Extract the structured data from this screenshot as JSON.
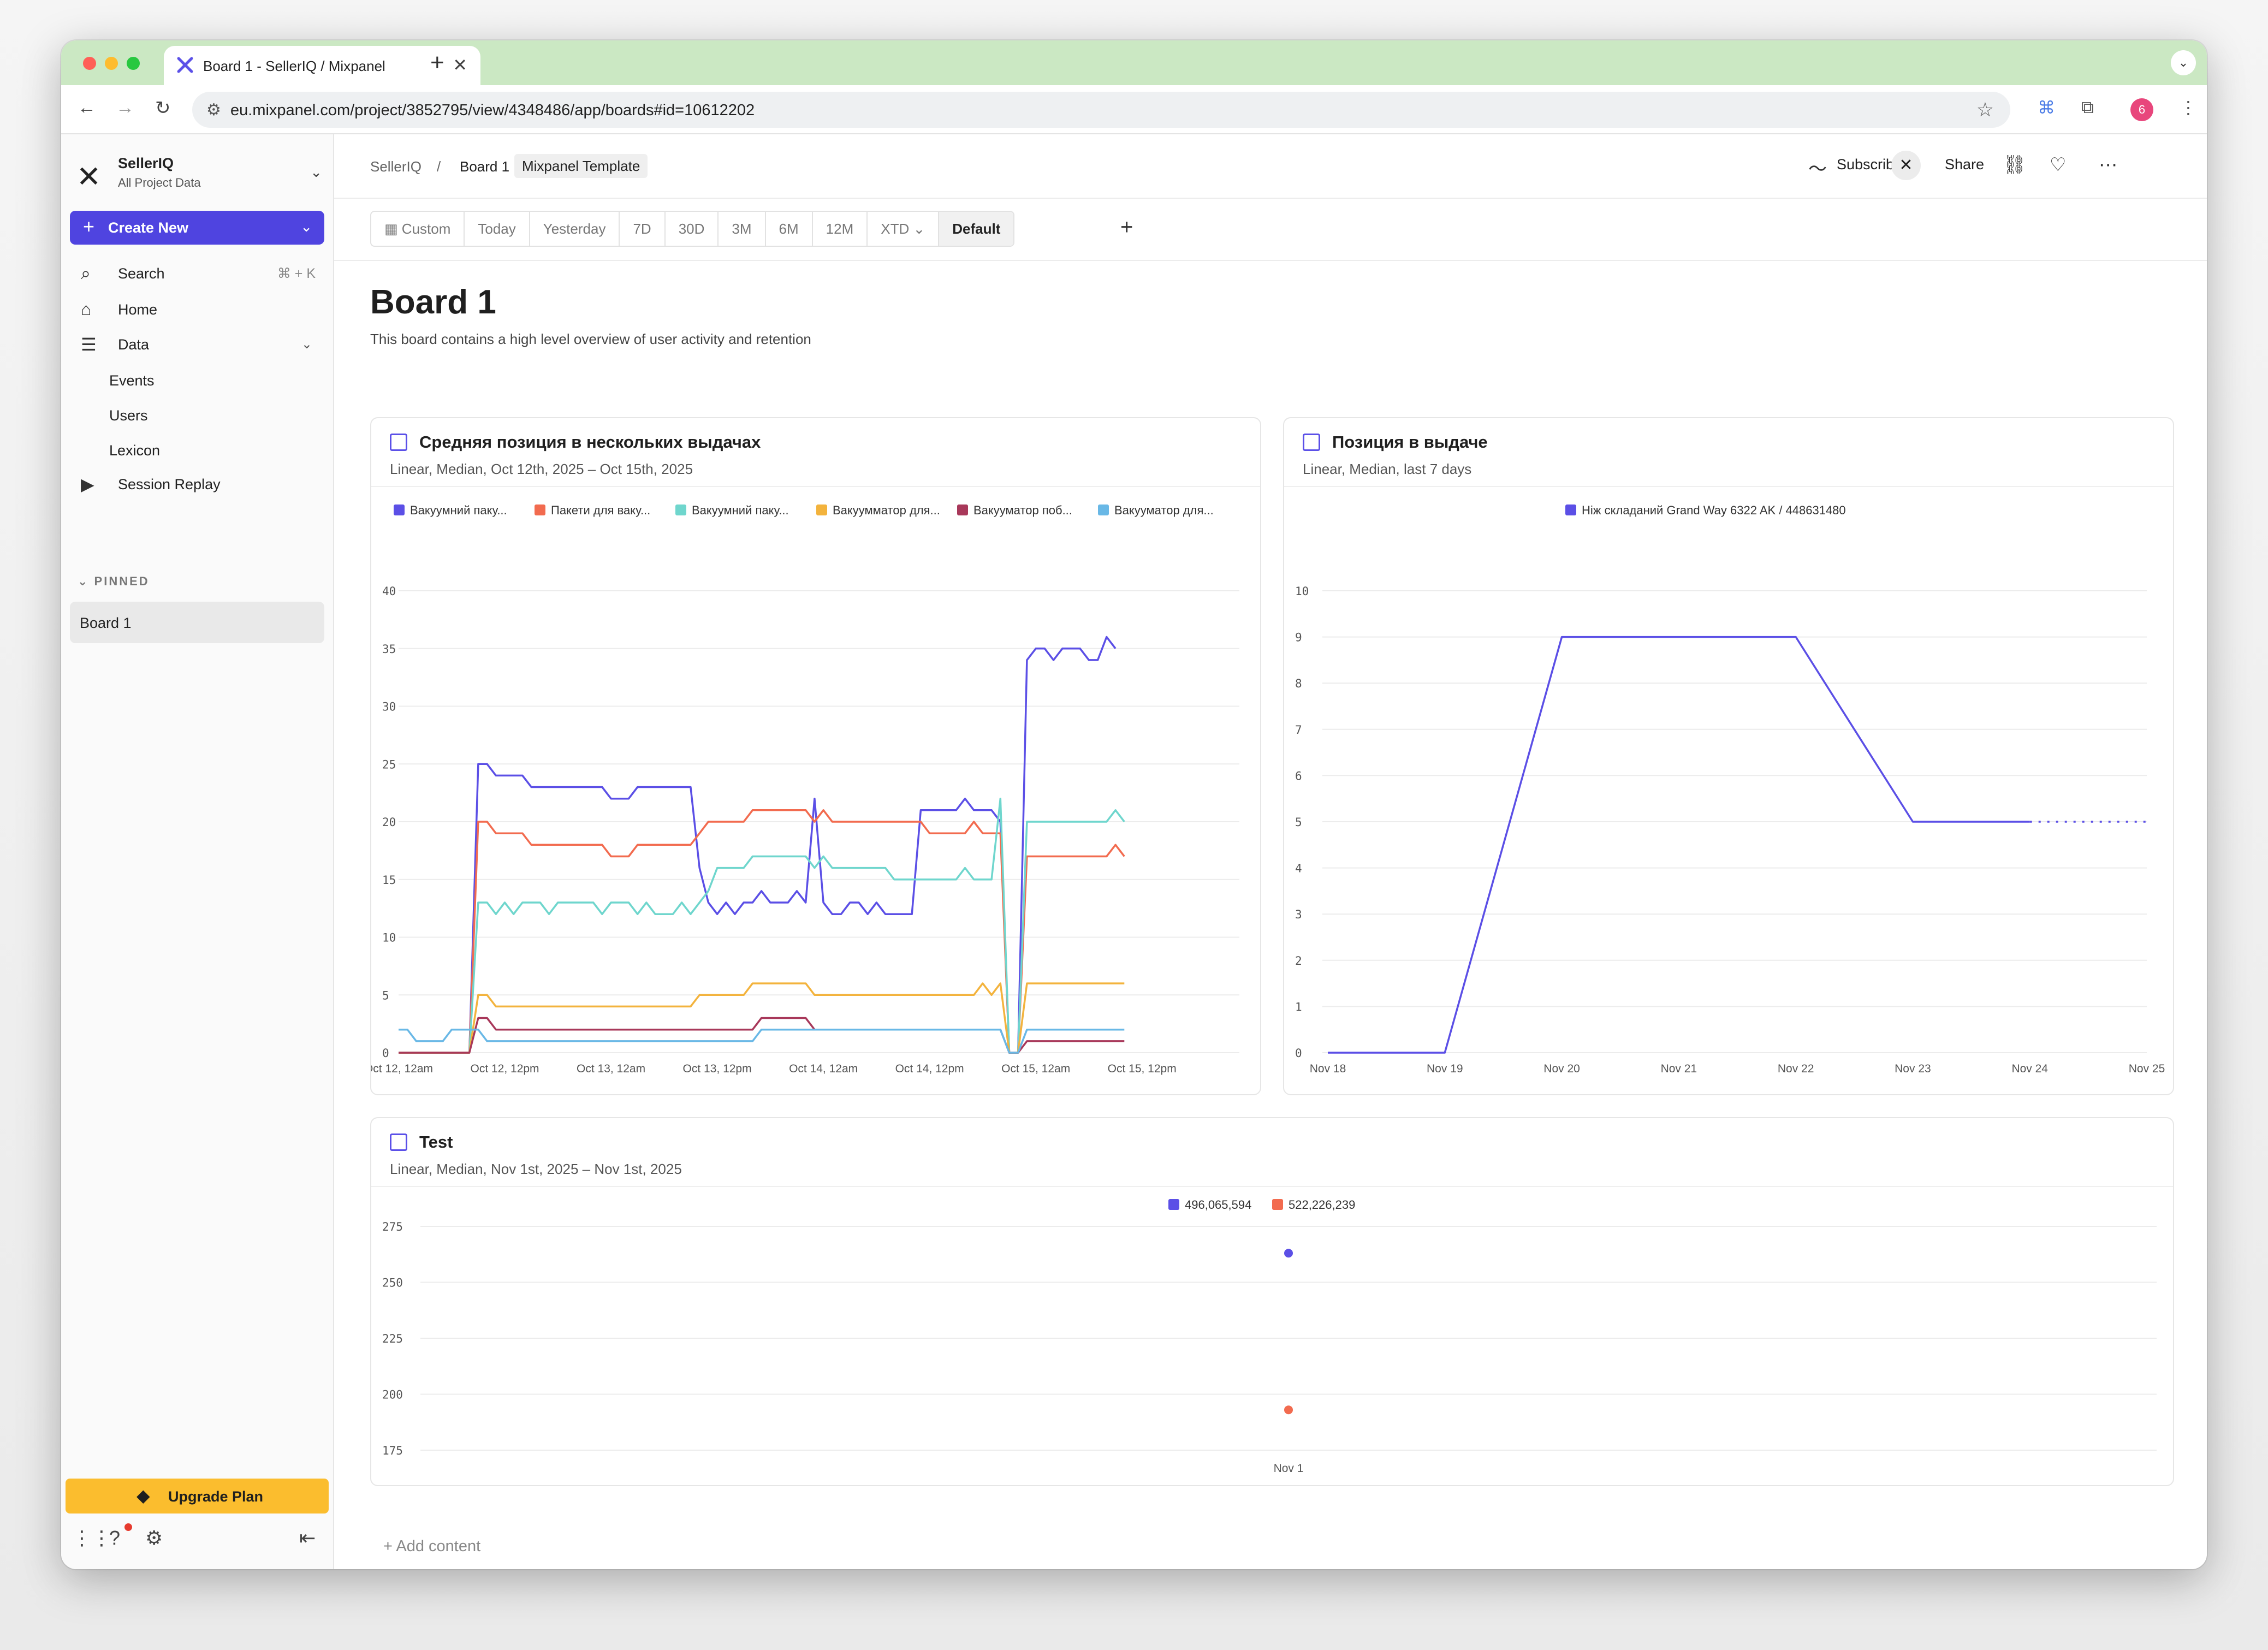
{
  "browser": {
    "tab_title": "Board 1 - SellerIQ / Mixpanel",
    "url": "eu.mixpanel.com/project/3852795/view/4348486/app/boards#id=10612202",
    "profile_badge": "6"
  },
  "sidebar": {
    "org_name": "SellerIQ",
    "org_sub": "All Project Data",
    "create_new": "Create New",
    "search": "Search",
    "search_shortcut": "⌘ + K",
    "home": "Home",
    "data": "Data",
    "events": "Events",
    "users": "Users",
    "lexicon": "Lexicon",
    "session_replay": "Session Replay",
    "pinned_header": "PINNED",
    "pinned_board": "Board 1",
    "upgrade": "Upgrade Plan"
  },
  "topbar": {
    "crumb_root": "SellerIQ",
    "crumb_sep": "/",
    "crumb_board": "Board 1",
    "template_tag": "Mixpanel Template",
    "subscribe": "Subscribe",
    "share": "Share"
  },
  "filters": {
    "options": [
      "Custom",
      "Today",
      "Yesterday",
      "7D",
      "30D",
      "3M",
      "6M",
      "12M",
      "XTD",
      "Default"
    ],
    "active": "Default"
  },
  "board": {
    "title": "Board 1",
    "description": "This board contains a high level overview of user activity and retention",
    "add_content": "+ Add content"
  },
  "cards": [
    {
      "title": "Средняя позиция в нескольких выдачах",
      "subtitle": "Linear, Median, Oct 12th, 2025 – Oct 15th, 2025"
    },
    {
      "title": "Позиция в выдаче",
      "subtitle": "Linear, Median, last 7 days"
    },
    {
      "title": "Test",
      "subtitle": "Linear, Median, Nov 1st, 2025 – Nov 1st, 2025"
    }
  ],
  "chart_data": [
    {
      "type": "line",
      "title": "Средняя позиция в нескольких выдачах",
      "ylim": [
        0,
        40
      ],
      "yticks": [
        0,
        5,
        10,
        15,
        20,
        25,
        30,
        35,
        40
      ],
      "xticks": [
        "Oct 12, 12am",
        "Oct 12, 12pm",
        "Oct 13, 12am",
        "Oct 13, 12pm",
        "Oct 14, 12am",
        "Oct 14, 12pm",
        "Oct 15, 12am",
        "Oct 15, 12pm"
      ],
      "x_hours_range": [
        0,
        95
      ],
      "series": [
        {
          "name": "Вакуумний паку...",
          "color": "#5b4fe6",
          "points": [
            [
              0,
              0
            ],
            [
              8,
              0
            ],
            [
              9,
              25
            ],
            [
              10,
              25
            ],
            [
              11,
              24
            ],
            [
              14,
              24
            ],
            [
              15,
              23
            ],
            [
              23,
              23
            ],
            [
              24,
              22
            ],
            [
              26,
              22
            ],
            [
              27,
              23
            ],
            [
              33,
              23
            ],
            [
              34,
              16
            ],
            [
              35,
              13
            ],
            [
              36,
              12
            ],
            [
              37,
              13
            ],
            [
              38,
              12
            ],
            [
              39,
              13
            ],
            [
              40,
              13
            ],
            [
              41,
              14
            ],
            [
              42,
              13
            ],
            [
              44,
              13
            ],
            [
              45,
              14
            ],
            [
              46,
              13
            ],
            [
              47,
              22
            ],
            [
              48,
              13
            ],
            [
              49,
              12
            ],
            [
              50,
              12
            ],
            [
              51,
              13
            ],
            [
              52,
              13
            ],
            [
              53,
              12
            ],
            [
              54,
              13
            ],
            [
              55,
              12
            ],
            [
              58,
              12
            ],
            [
              59,
              21
            ],
            [
              63,
              21
            ],
            [
              64,
              22
            ],
            [
              65,
              21
            ],
            [
              67,
              21
            ],
            [
              68,
              20
            ],
            [
              69,
              0
            ],
            [
              70,
              0
            ],
            [
              71,
              34
            ],
            [
              72,
              35
            ],
            [
              73,
              35
            ],
            [
              74,
              34
            ],
            [
              75,
              35
            ],
            [
              77,
              35
            ],
            [
              78,
              34
            ],
            [
              79,
              34
            ],
            [
              80,
              36
            ],
            [
              81,
              35
            ]
          ]
        },
        {
          "name": "Пакети для ваку...",
          "color": "#f26b4f",
          "points": [
            [
              0,
              0
            ],
            [
              8,
              0
            ],
            [
              9,
              20
            ],
            [
              10,
              20
            ],
            [
              11,
              19
            ],
            [
              14,
              19
            ],
            [
              15,
              18
            ],
            [
              23,
              18
            ],
            [
              24,
              17
            ],
            [
              26,
              17
            ],
            [
              27,
              18
            ],
            [
              33,
              18
            ],
            [
              34,
              19
            ],
            [
              35,
              20
            ],
            [
              39,
              20
            ],
            [
              40,
              21
            ],
            [
              46,
              21
            ],
            [
              47,
              20
            ],
            [
              48,
              21
            ],
            [
              49,
              20
            ],
            [
              59,
              20
            ],
            [
              60,
              19
            ],
            [
              64,
              19
            ],
            [
              65,
              20
            ],
            [
              66,
              19
            ],
            [
              68,
              19
            ],
            [
              69,
              0
            ],
            [
              70,
              0
            ],
            [
              71,
              17
            ],
            [
              80,
              17
            ],
            [
              81,
              18
            ],
            [
              82,
              17
            ]
          ]
        },
        {
          "name": "Вакуумний паку...",
          "color": "#6fd6cd",
          "points": [
            [
              0,
              0
            ],
            [
              8,
              0
            ],
            [
              9,
              13
            ],
            [
              10,
              13
            ],
            [
              11,
              12
            ],
            [
              12,
              13
            ],
            [
              13,
              12
            ],
            [
              14,
              13
            ],
            [
              16,
              13
            ],
            [
              17,
              12
            ],
            [
              18,
              13
            ],
            [
              22,
              13
            ],
            [
              23,
              12
            ],
            [
              24,
              13
            ],
            [
              26,
              13
            ],
            [
              27,
              12
            ],
            [
              28,
              13
            ],
            [
              29,
              12
            ],
            [
              31,
              12
            ],
            [
              32,
              13
            ],
            [
              33,
              12
            ],
            [
              34,
              13
            ],
            [
              35,
              14
            ],
            [
              36,
              16
            ],
            [
              39,
              16
            ],
            [
              40,
              17
            ],
            [
              46,
              17
            ],
            [
              47,
              16
            ],
            [
              48,
              17
            ],
            [
              49,
              16
            ],
            [
              55,
              16
            ],
            [
              56,
              15
            ],
            [
              63,
              15
            ],
            [
              64,
              16
            ],
            [
              65,
              15
            ],
            [
              67,
              15
            ],
            [
              68,
              22
            ],
            [
              69,
              0
            ],
            [
              70,
              0
            ],
            [
              71,
              20
            ],
            [
              80,
              20
            ],
            [
              81,
              21
            ],
            [
              82,
              20
            ]
          ]
        },
        {
          "name": "Вакуумматор для...",
          "color": "#f3b33d",
          "points": [
            [
              0,
              0
            ],
            [
              8,
              0
            ],
            [
              9,
              5
            ],
            [
              10,
              5
            ],
            [
              11,
              4
            ],
            [
              33,
              4
            ],
            [
              34,
              5
            ],
            [
              39,
              5
            ],
            [
              40,
              6
            ],
            [
              46,
              6
            ],
            [
              47,
              5
            ],
            [
              65,
              5
            ],
            [
              66,
              6
            ],
            [
              67,
              5
            ],
            [
              68,
              6
            ],
            [
              69,
              0
            ],
            [
              70,
              0
            ],
            [
              71,
              6
            ],
            [
              82,
              6
            ]
          ]
        },
        {
          "name": "Вакууматор поб...",
          "color": "#a8385a",
          "points": [
            [
              0,
              0
            ],
            [
              8,
              0
            ],
            [
              9,
              3
            ],
            [
              10,
              3
            ],
            [
              11,
              2
            ],
            [
              40,
              2
            ],
            [
              41,
              3
            ],
            [
              46,
              3
            ],
            [
              47,
              2
            ],
            [
              68,
              2
            ],
            [
              69,
              0
            ],
            [
              70,
              0
            ],
            [
              71,
              1
            ],
            [
              82,
              1
            ]
          ]
        },
        {
          "name": "Вакууматор для...",
          "color": "#69b8e6",
          "points": [
            [
              0,
              2
            ],
            [
              1,
              2
            ],
            [
              2,
              1
            ],
            [
              5,
              1
            ],
            [
              6,
              2
            ],
            [
              9,
              2
            ],
            [
              10,
              1
            ],
            [
              40,
              1
            ],
            [
              41,
              2
            ],
            [
              68,
              2
            ],
            [
              69,
              0
            ],
            [
              70,
              0
            ],
            [
              71,
              2
            ],
            [
              82,
              2
            ]
          ]
        }
      ]
    },
    {
      "type": "line",
      "title": "Позиция в выдаче",
      "ylim": [
        0,
        10
      ],
      "yticks": [
        0,
        1,
        2,
        3,
        4,
        5,
        6,
        7,
        8,
        9,
        10
      ],
      "categories": [
        "Nov 18",
        "Nov 19",
        "Nov 20",
        "Nov 21",
        "Nov 22",
        "Nov 23",
        "Nov 24",
        "Nov 25"
      ],
      "series": [
        {
          "name": "Ніж складаний Grand Way 6322 AK / 448631480",
          "color": "#5b4fe6",
          "values": [
            0,
            0,
            9,
            9,
            9,
            5,
            5,
            5
          ],
          "dashed_from_index": 6
        }
      ]
    },
    {
      "type": "scatter",
      "title": "Test",
      "ylim": [
        175,
        275
      ],
      "yticks": [
        175,
        200,
        225,
        250,
        275
      ],
      "categories": [
        "Nov 1"
      ],
      "series": [
        {
          "name": "496,065,594",
          "color": "#5b4fe6",
          "values": [
            263
          ]
        },
        {
          "name": "522,226,239",
          "color": "#f26b4f",
          "values": [
            193
          ]
        }
      ]
    }
  ],
  "colors": {
    "accent": "#4f44e0",
    "upgrade": "#fbbd2e",
    "tabstrip": "#cbe8c3"
  }
}
